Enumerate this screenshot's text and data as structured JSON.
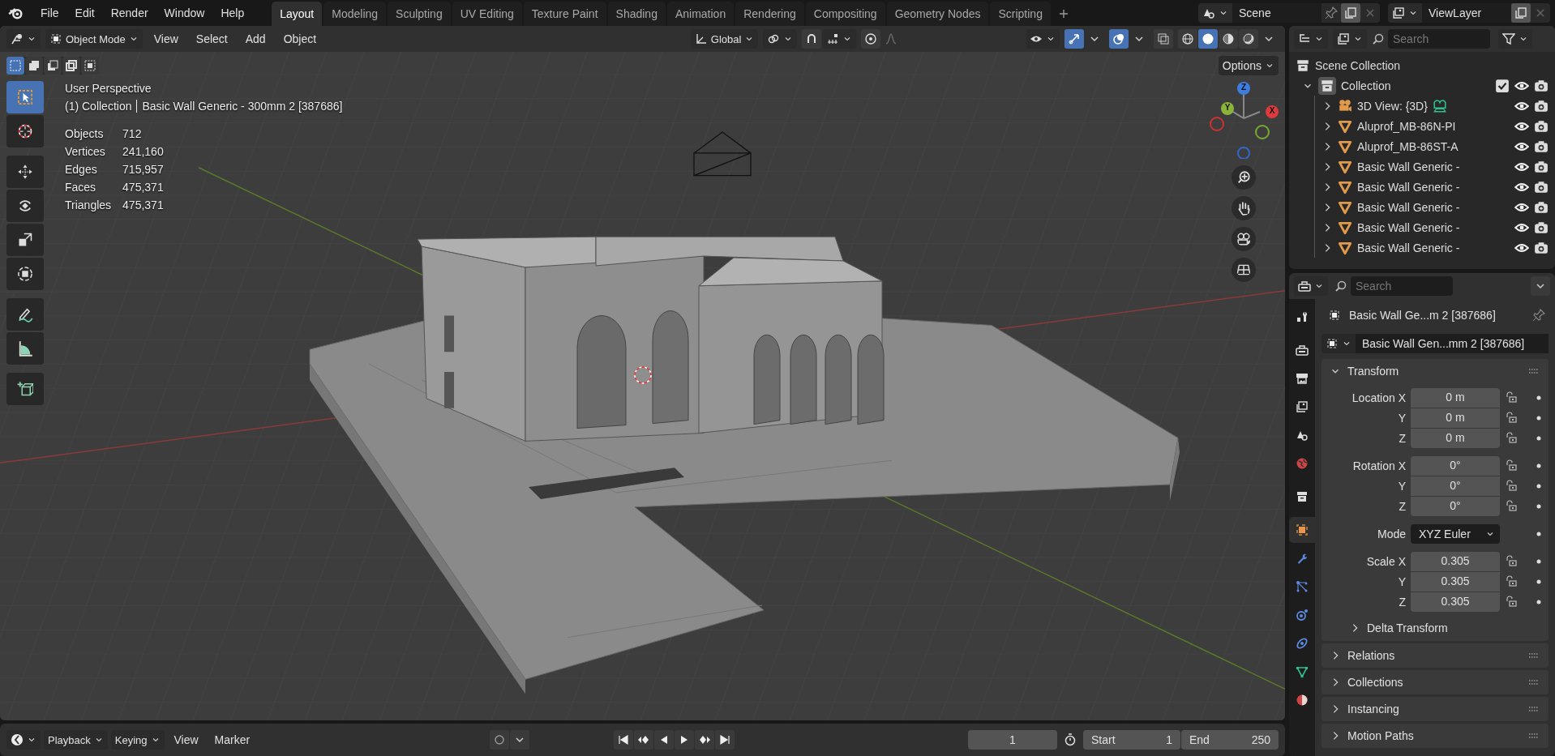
{
  "top_menu": [
    "File",
    "Edit",
    "Render",
    "Window",
    "Help"
  ],
  "workspace_tabs": [
    {
      "label": "Layout",
      "selected": true
    },
    {
      "label": "Modeling",
      "selected": false
    },
    {
      "label": "Sculpting",
      "selected": false
    },
    {
      "label": "UV Editing",
      "selected": false
    },
    {
      "label": "Texture Paint",
      "selected": false
    },
    {
      "label": "Shading",
      "selected": false
    },
    {
      "label": "Animation",
      "selected": false
    },
    {
      "label": "Rendering",
      "selected": false
    },
    {
      "label": "Compositing",
      "selected": false
    },
    {
      "label": "Geometry Nodes",
      "selected": false
    },
    {
      "label": "Scripting",
      "selected": false
    }
  ],
  "scene": {
    "name": "Scene"
  },
  "view_layer": {
    "name": "ViewLayer"
  },
  "viewport_header": {
    "mode": "Object Mode",
    "menus": [
      "View",
      "Select",
      "Add",
      "Object"
    ],
    "orientation": "Global",
    "options": "Options"
  },
  "select_modes": [
    {
      "selected": true
    },
    {
      "selected": false
    },
    {
      "selected": false
    },
    {
      "selected": false
    },
    {
      "selected": false
    }
  ],
  "shading_modes": [
    {
      "kind": "wire",
      "selected": false
    },
    {
      "kind": "solid",
      "selected": true
    },
    {
      "kind": "material",
      "selected": false
    },
    {
      "kind": "rendered",
      "selected": false
    }
  ],
  "tools": [
    {
      "kind": "select",
      "selected": true
    },
    {
      "kind": "cursor",
      "selected": false
    },
    {
      "kind": "move",
      "selected": false
    },
    {
      "kind": "rotate",
      "selected": false
    },
    {
      "kind": "scale",
      "selected": false
    },
    {
      "kind": "transform",
      "selected": false
    },
    {
      "kind": "annotate",
      "selected": false
    },
    {
      "kind": "measure",
      "selected": false
    },
    {
      "kind": "add_cube",
      "selected": false
    }
  ],
  "overlay_info": {
    "perspective": "User Perspective",
    "collection": "(1) Collection",
    "object": "Basic Wall Generic - 300mm 2 [387686]"
  },
  "stats": [
    {
      "label": "Objects",
      "value": "712"
    },
    {
      "label": "Vertices",
      "value": "241,160"
    },
    {
      "label": "Edges",
      "value": "715,957"
    },
    {
      "label": "Faces",
      "value": "475,371"
    },
    {
      "label": "Triangles",
      "value": "475,371"
    }
  ],
  "gizmo_axes": [
    "Y",
    "X",
    "Z"
  ],
  "outliner": {
    "search": {
      "placeholder": "Search"
    },
    "root": "Scene Collection",
    "collection": {
      "label": "Collection",
      "expanded": true,
      "checked": true
    },
    "items": [
      {
        "kind": "camera",
        "label": "3D View: {3D}"
      },
      {
        "kind": "mesh",
        "label": "Aluprof_MB-86N-PI"
      },
      {
        "kind": "mesh",
        "label": "Aluprof_MB-86ST-A"
      },
      {
        "kind": "mesh",
        "label": "Basic Wall Generic -"
      },
      {
        "kind": "mesh",
        "label": "Basic Wall Generic -"
      },
      {
        "kind": "mesh",
        "label": "Basic Wall Generic -"
      },
      {
        "kind": "mesh",
        "label": "Basic Wall Generic -"
      },
      {
        "kind": "mesh",
        "label": "Basic Wall Generic -"
      }
    ]
  },
  "properties": {
    "search": {
      "placeholder": "Search"
    },
    "object_name": "Basic Wall Ge...m 2 [387686]",
    "object_field": "Basic Wall Gen...mm 2 [387686]",
    "tabs": [
      {
        "kind": "tool",
        "selected": false
      },
      {
        "kind": "render",
        "selected": false
      },
      {
        "kind": "output",
        "selected": false
      },
      {
        "kind": "view_layer",
        "selected": false
      },
      {
        "kind": "scene",
        "selected": false
      },
      {
        "kind": "world",
        "selected": false
      },
      {
        "kind": "collection",
        "selected": false
      },
      {
        "kind": "object",
        "selected": true
      },
      {
        "kind": "modifier",
        "selected": false
      },
      {
        "kind": "particles",
        "selected": false
      },
      {
        "kind": "physics",
        "selected": false
      },
      {
        "kind": "constraint",
        "selected": false
      },
      {
        "kind": "data",
        "selected": false
      },
      {
        "kind": "material",
        "selected": false
      }
    ],
    "transform": {
      "title": "Transform",
      "expanded": true,
      "rows": [
        {
          "kind": "field",
          "label": "Location X",
          "value": "0 m"
        },
        {
          "kind": "field",
          "label": "Y",
          "value": "0 m"
        },
        {
          "kind": "field",
          "label": "Z",
          "value": "0 m"
        },
        {
          "kind": "field",
          "label": "Rotation X",
          "value": "0°"
        },
        {
          "kind": "field",
          "label": "Y",
          "value": "0°"
        },
        {
          "kind": "field",
          "label": "Z",
          "value": "0°"
        },
        {
          "kind": "dropdown",
          "label": "Mode",
          "value": "XYZ Euler"
        },
        {
          "kind": "field",
          "label": "Scale X",
          "value": "0.305"
        },
        {
          "kind": "field",
          "label": "Y",
          "value": "0.305"
        },
        {
          "kind": "field",
          "label": "Z",
          "value": "0.305"
        }
      ],
      "sub_panel": {
        "title": "Delta Transform",
        "expanded": false
      }
    },
    "panels": [
      {
        "title": "Relations",
        "expanded": false
      },
      {
        "title": "Collections",
        "expanded": false
      },
      {
        "title": "Instancing",
        "expanded": false
      },
      {
        "title": "Motion Paths",
        "expanded": false
      }
    ]
  },
  "timeline": {
    "menus": [
      "Playback",
      "Keying"
    ],
    "items": [
      "View",
      "Marker"
    ],
    "current_frame": "1",
    "start": {
      "label": "Start",
      "value": "1"
    },
    "end": {
      "label": "End",
      "value": "250"
    }
  }
}
